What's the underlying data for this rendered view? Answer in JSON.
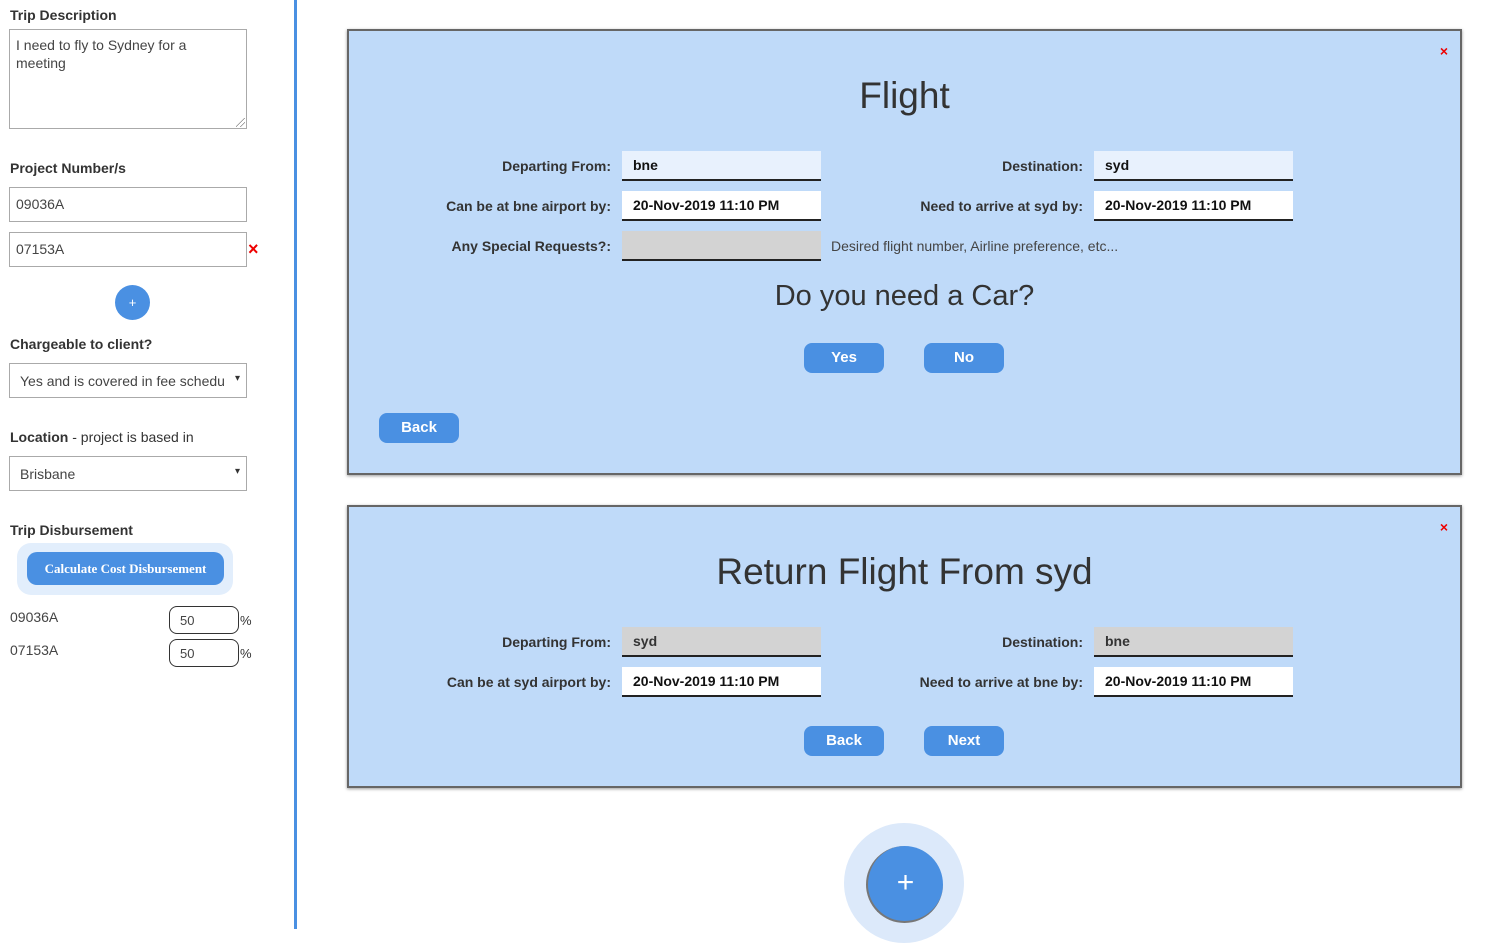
{
  "sidebar": {
    "trip_description_label": "Trip Description",
    "trip_description_value": "I need to fly to Sydney for a meeting",
    "project_numbers_label": "Project Number/s",
    "projects": [
      "09036A",
      "07153A"
    ],
    "remove_symbol": "×",
    "add_symbol": "+",
    "chargeable_label": "Chargeable to client?",
    "chargeable_value": "Yes and is covered in fee schedu",
    "location_label_bold": "Location",
    "location_label_rest": " - project is based in",
    "location_value": "Brisbane",
    "caret": "▾",
    "disbursement_label": "Trip Disbursement",
    "calc_button": "Calculate Cost Disbursement",
    "disbursements": [
      {
        "code": "09036A",
        "value": "50"
      },
      {
        "code": "07153A",
        "value": "50"
      }
    ],
    "percent_sign": "%"
  },
  "flight": {
    "title": "Flight",
    "close": "×",
    "departing_label": "Departing From:",
    "departing_value": "bne",
    "destination_label": "Destination:",
    "destination_value": "syd",
    "airport_by_label": "Can be at bne airport by:",
    "airport_by_value": "20-Nov-2019 11:10 PM",
    "arrive_by_label": "Need to arrive at syd by:",
    "arrive_by_value": "20-Nov-2019 11:10 PM",
    "special_label": "Any Special Requests?:",
    "special_value": "",
    "special_hint": "Desired flight number, Airline preference, etc...",
    "car_question": "Do you need a Car?",
    "yes_button": "Yes",
    "no_button": "No",
    "back_button": "Back"
  },
  "return_flight": {
    "title": "Return Flight From syd",
    "close": "×",
    "departing_label": "Departing From:",
    "departing_value": "syd",
    "destination_label": "Destination:",
    "destination_value": "bne",
    "airport_by_label": "Can be at syd airport by:",
    "airport_by_value": "20-Nov-2019 11:10 PM",
    "arrive_by_label": "Need to arrive at bne by:",
    "arrive_by_value": "20-Nov-2019 11:10 PM",
    "back_button": "Back",
    "next_button": "Next"
  },
  "fab": {
    "symbol": "+"
  },
  "colors": {
    "accent": "#4a90e2",
    "panel": "#bfdaf9",
    "remove": "#ee0000"
  }
}
